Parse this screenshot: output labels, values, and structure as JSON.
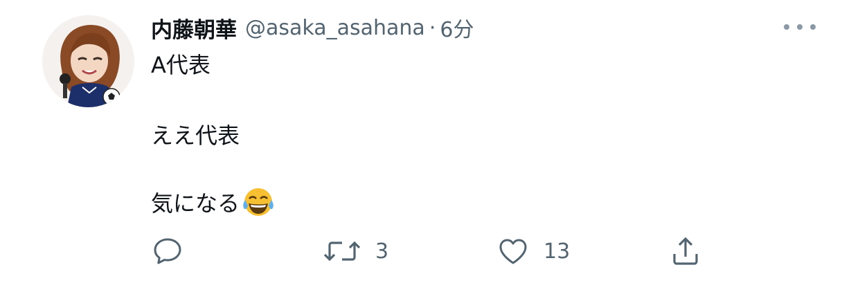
{
  "tweet": {
    "author_name": "内藤朝華",
    "handle": "@asaka_asahana",
    "separator": "·",
    "time": "6分",
    "lines": [
      "A代表",
      "ええ代表",
      "気になる"
    ],
    "emoji": "face-with-tears-of-joy"
  },
  "actions": {
    "reply_count": "",
    "retweet_count": "3",
    "like_count": "13"
  },
  "colors": {
    "text": "#0f1419",
    "secondary": "#536471",
    "icon": "#536471"
  }
}
